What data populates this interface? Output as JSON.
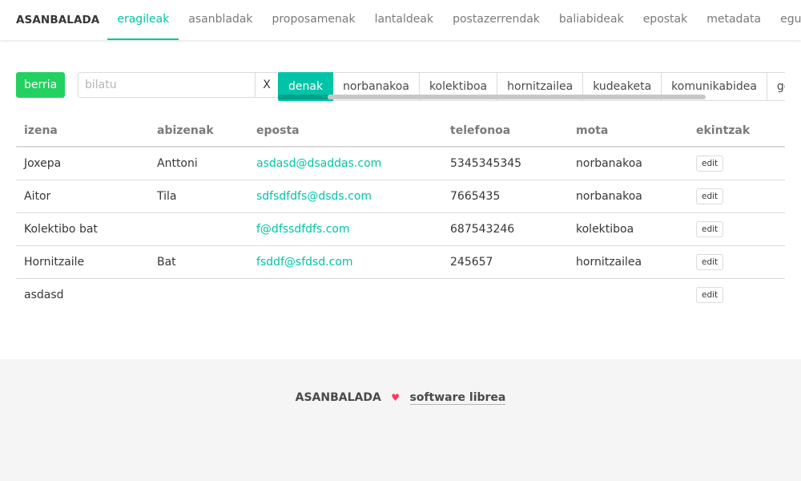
{
  "nav": {
    "brand": "ASANBALADA",
    "items": [
      {
        "label": "eragileak",
        "active": true
      },
      {
        "label": "asanbladak"
      },
      {
        "label": "proposamenak"
      },
      {
        "label": "lantaldeak"
      },
      {
        "label": "postazerrendak"
      },
      {
        "label": "baliabideak"
      },
      {
        "label": "epostak"
      },
      {
        "label": "metadata"
      },
      {
        "label": "egutegia"
      }
    ]
  },
  "toolbar": {
    "new_label": "berria",
    "search_placeholder": "bilatu",
    "search_value": "",
    "clear_label": "X",
    "filters": [
      {
        "label": "denak",
        "active": true
      },
      {
        "label": "norbanakoa"
      },
      {
        "label": "kolektiboa"
      },
      {
        "label": "hornitzailea"
      },
      {
        "label": "kudeaketa"
      },
      {
        "label": "komunikabidea"
      },
      {
        "label": "gobernu"
      }
    ]
  },
  "table": {
    "headers": [
      "izena",
      "abizenak",
      "eposta",
      "telefonoa",
      "mota",
      "ekintzak"
    ],
    "rows": [
      {
        "izena": "Joxepa",
        "abizenak": "Anttoni",
        "eposta": "asdasd@dsaddas.com",
        "telefonoa": "5345345345",
        "mota": "norbanakoa",
        "action": "edit"
      },
      {
        "izena": "Aitor",
        "abizenak": "Tila",
        "eposta": "sdfsdfdfs@dsds.com",
        "telefonoa": "7665435",
        "mota": "norbanakoa",
        "action": "edit"
      },
      {
        "izena": "Kolektibo bat",
        "abizenak": "",
        "eposta": "f@dfssdfdfs.com",
        "telefonoa": "687543246",
        "mota": "kolektiboa",
        "action": "edit"
      },
      {
        "izena": "Hornitzaile",
        "abizenak": "Bat",
        "eposta": "fsddf@sfdsd.com",
        "telefonoa": "245657",
        "mota": "hornitzailea",
        "action": "edit"
      },
      {
        "izena": "asdasd",
        "abizenak": "",
        "eposta": "",
        "telefonoa": "",
        "mota": "",
        "action": "edit"
      }
    ]
  },
  "footer": {
    "brand": "ASANBALADA",
    "heart_icon": "heart-icon",
    "link_label": "software librea"
  },
  "colors": {
    "accent": "#00c4a7",
    "new_button": "#23d160",
    "heart": "#ff3860"
  }
}
